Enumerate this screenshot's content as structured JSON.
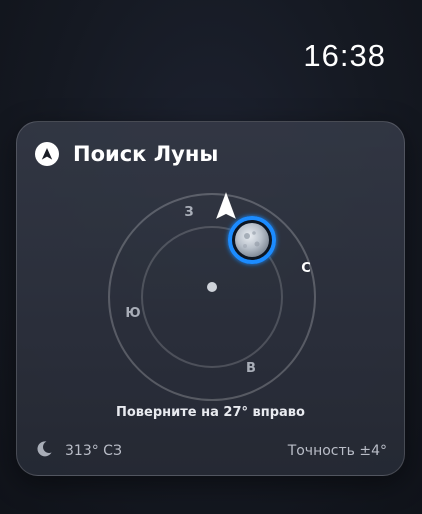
{
  "status_bar": {
    "time": "16:38"
  },
  "widget": {
    "title": "Поиск Луны",
    "title_icon": "compass-arrow-icon",
    "compass": {
      "labels": {
        "north_side": "З",
        "east_side": "С",
        "south_side": "В",
        "west_side": "Ю"
      },
      "indicator_icon": "navigation-arrow-icon",
      "target_icon": "moon-icon",
      "accent_color": "#1e8cff"
    },
    "instruction": "Поверните на 27° вправо",
    "footer": {
      "moon_icon": "crescent-moon-icon",
      "azimuth": "313° СЗ",
      "accuracy": "Точность ±4°"
    }
  }
}
